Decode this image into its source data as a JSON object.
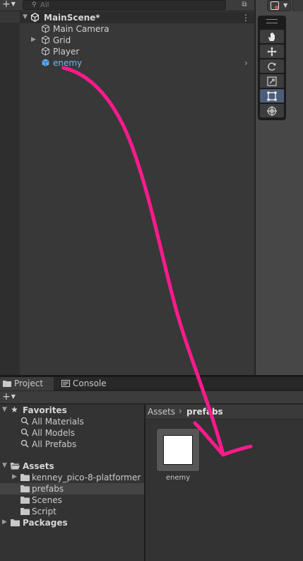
{
  "hierarchy": {
    "search_placeholder": "All",
    "scene_name": "MainScene*",
    "items": [
      {
        "label": "Main Camera",
        "has_children": false,
        "prefab": false
      },
      {
        "label": "Grid",
        "has_children": true,
        "prefab": false
      },
      {
        "label": "Player",
        "has_children": false,
        "prefab": false
      },
      {
        "label": "enemy",
        "has_children": false,
        "prefab": true
      }
    ]
  },
  "scene_tools": {
    "tools": [
      "hand-tool",
      "move-tool",
      "rotate-tool",
      "scale-tool",
      "rect-tool",
      "transform-tool"
    ],
    "active_tool": "rect-tool"
  },
  "bottom_tabs": [
    {
      "label": "Project",
      "active": true
    },
    {
      "label": "Console",
      "active": false
    }
  ],
  "project": {
    "tree": {
      "favorites": {
        "label": "Favorites",
        "items": [
          "All Materials",
          "All Models",
          "All Prefabs"
        ]
      },
      "assets": {
        "label": "Assets",
        "folders": [
          "kenney_pico-8-platformer",
          "prefabs",
          "Scenes",
          "Script"
        ],
        "selected": "prefabs"
      },
      "packages": {
        "label": "Packages"
      }
    },
    "breadcrumb": {
      "root": "Assets",
      "current": "prefabs"
    },
    "assets": [
      {
        "name": "enemy",
        "type": "prefab"
      }
    ]
  },
  "colors": {
    "prefab_label": "#6fb7f5",
    "annotation_arrow": "#ff1a8c",
    "active_tool": "#4d5d78"
  }
}
